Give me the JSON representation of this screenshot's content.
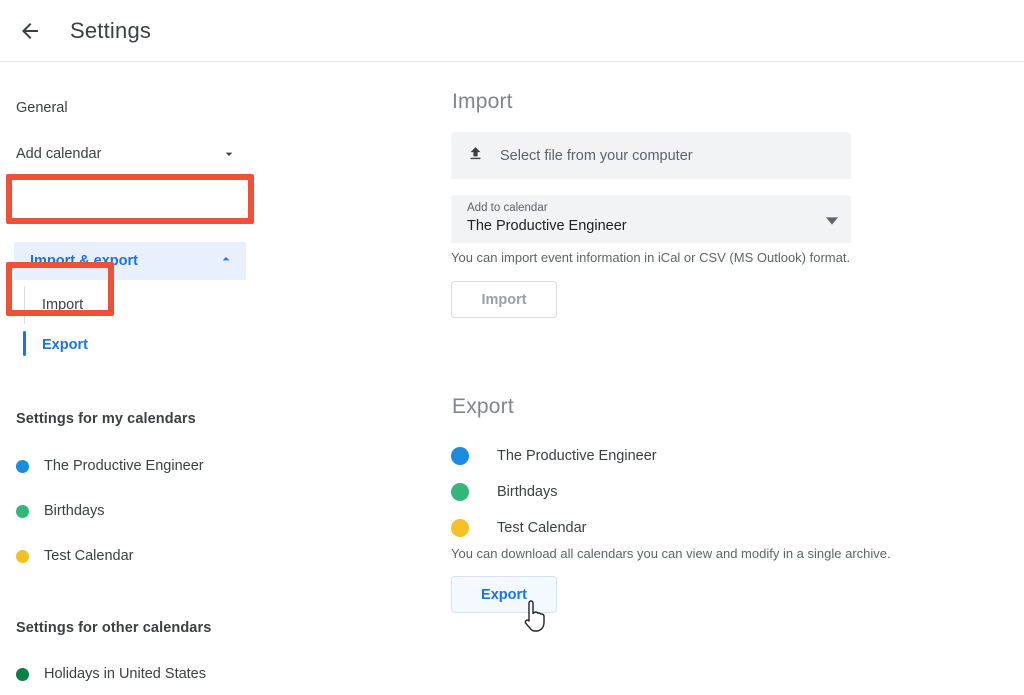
{
  "header": {
    "back_icon": "back-arrow-icon",
    "title": "Settings"
  },
  "sidebar": {
    "general_label": "General",
    "add_calendar_label": "Add calendar",
    "add_calendar_caret": "chevron-down-icon",
    "import_export_label": "Import & export",
    "import_export_caret": "chevron-up-icon",
    "sub_items": [
      {
        "label": "Import",
        "active": false
      },
      {
        "label": "Export",
        "active": true
      }
    ],
    "my_calendars_title": "Settings for my calendars",
    "my_calendars": [
      {
        "name": "The Productive Engineer",
        "color": "#1a8cdd"
      },
      {
        "name": "Birthdays",
        "color": "#33b679"
      },
      {
        "name": "Test Calendar",
        "color": "#f6bf26"
      }
    ],
    "other_calendars_title": "Settings for other calendars",
    "other_calendars": [
      {
        "name": "Holidays in United States",
        "color": "#0b8043"
      }
    ]
  },
  "import_section": {
    "heading": "Import",
    "file_picker_icon": "upload-icon",
    "file_picker_label": "Select file from your computer",
    "select_label": "Add to calendar",
    "select_value": "The Productive Engineer",
    "select_caret": "dropdown-caret-icon",
    "helper_text": "You can import event information in iCal or CSV (MS Outlook) format.",
    "button_label": "Import"
  },
  "export_section": {
    "heading": "Export",
    "calendars": [
      {
        "name": "The Productive Engineer",
        "color": "#1a8cdd"
      },
      {
        "name": "Birthdays",
        "color": "#33b679"
      },
      {
        "name": "Test Calendar",
        "color": "#f6bf26"
      }
    ],
    "helper_text": "You can download all calendars you can view and modify in a single archive.",
    "button_label": "Export"
  },
  "annotations": {
    "color": "#ef5136",
    "boxes": [
      {
        "target": "Import & export"
      },
      {
        "target": "Export"
      }
    ]
  },
  "cursor": {
    "type": "pointer-hand-cursor"
  },
  "colors": {
    "accent_blue": "#1a73e8",
    "highlight_bg": "#e8f0fe",
    "field_bg": "#f1f3f4",
    "annotation_red": "#ef5136"
  }
}
